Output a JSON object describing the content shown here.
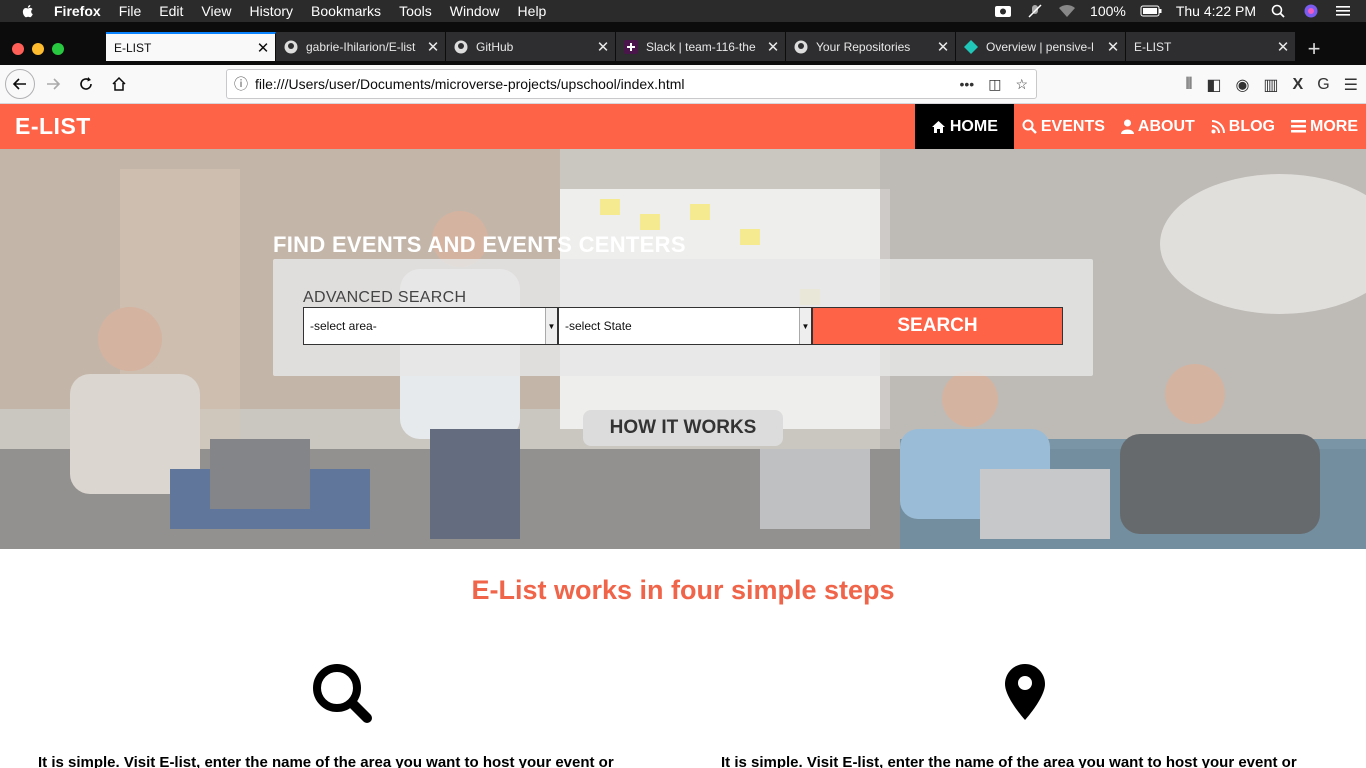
{
  "menubar": {
    "app": "Firefox",
    "items": [
      "File",
      "Edit",
      "View",
      "History",
      "Bookmarks",
      "Tools",
      "Window",
      "Help"
    ],
    "battery": "100%",
    "clock": "Thu 4:22 PM"
  },
  "tabs": [
    {
      "title": "E-LIST",
      "active": true
    },
    {
      "title": "gabrie-Ihilarion/E-list",
      "active": false
    },
    {
      "title": "GitHub",
      "active": false
    },
    {
      "title": "Slack | team-116-the",
      "active": false
    },
    {
      "title": "Your Repositories",
      "active": false
    },
    {
      "title": "Overview | pensive-l",
      "active": false
    },
    {
      "title": "E-LIST",
      "active": false
    }
  ],
  "browser": {
    "url": "file:///Users/user/Documents/microverse-projects/upschool/index.html"
  },
  "site": {
    "brand": "E-LIST",
    "nav": [
      {
        "label": "HOME",
        "icon": "home-icon"
      },
      {
        "label": "EVENTS",
        "icon": "search-icon"
      },
      {
        "label": "ABOUT",
        "icon": "user-icon"
      },
      {
        "label": "BLOG",
        "icon": "rss-icon"
      },
      {
        "label": "MORE",
        "icon": "menu-icon"
      }
    ],
    "accent": "#ff6347"
  },
  "hero": {
    "title": "FIND EVENTS AND EVENTS CENTERS",
    "advanced_label": "ADVANCED SEARCH",
    "area_select": "-select area-",
    "state_select": "-select State",
    "search_button": "SEARCH",
    "how_button": "HOW IT WORKS"
  },
  "steps": {
    "title": "E-List works in four simple steps",
    "items": [
      {
        "icon": "search-icon",
        "text": "It is simple. Visit E-list, enter the name of the area you want to host your event or"
      },
      {
        "icon": "map-marker-icon",
        "text": "It is simple. Visit E-list, enter the name of the area you want to host your event or"
      }
    ]
  }
}
